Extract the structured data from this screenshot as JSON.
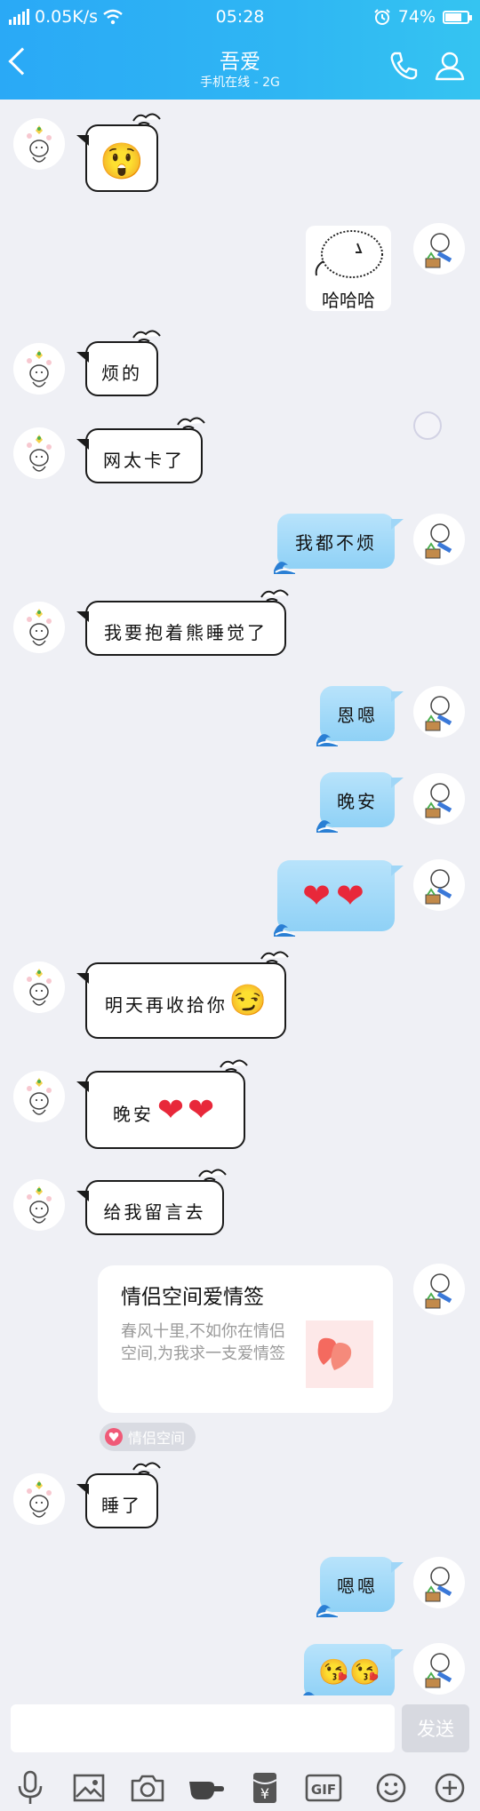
{
  "status": {
    "speed": "0.05K/s",
    "time": "05:28",
    "battery": "74%",
    "battery_level": 0.74
  },
  "header": {
    "title": "吾爱",
    "subtitle": "手机在线 - 2G"
  },
  "messages": [
    {
      "from": "them",
      "kind": "emoji",
      "content": "😲"
    },
    {
      "from": "me",
      "kind": "sticker",
      "content": "哈哈哈"
    },
    {
      "from": "them",
      "kind": "text",
      "content": "烦的"
    },
    {
      "from": "them",
      "kind": "text",
      "content": "网太卡了"
    },
    {
      "from": "me",
      "kind": "text",
      "content": "我都不烦"
    },
    {
      "from": "them",
      "kind": "text",
      "content": "我要抱着熊睡觉了"
    },
    {
      "from": "me",
      "kind": "text",
      "content": "恩嗯"
    },
    {
      "from": "me",
      "kind": "text",
      "content": "晚安"
    },
    {
      "from": "me",
      "kind": "emoji",
      "content": "❤❤"
    },
    {
      "from": "them",
      "kind": "text",
      "content": "明天再收拾你"
    },
    {
      "from": "them",
      "kind": "text",
      "content": "晚安"
    },
    {
      "from": "them",
      "kind": "text",
      "content": "给我留言去"
    },
    {
      "from": "them",
      "kind": "text",
      "content": "睡了"
    },
    {
      "from": "me",
      "kind": "text",
      "content": "嗯嗯"
    },
    {
      "from": "me",
      "kind": "emoji",
      "content": "😘😘"
    }
  ],
  "card": {
    "title": "情侣空间爱情签",
    "body": "春风十里,不如你在情侣空间,为我求一支爱情签",
    "tag": "情侣空间"
  },
  "input": {
    "placeholder": "",
    "send_label": "发送"
  },
  "toolbar": [
    "mic-icon",
    "image-icon",
    "camera-icon",
    "poke-icon",
    "red-packet-icon",
    "gif-icon",
    "emoji-icon",
    "plus-icon"
  ],
  "colors": {
    "header": "#2fb6f3",
    "background": "#eff0f5",
    "heart": "#e8283a"
  }
}
